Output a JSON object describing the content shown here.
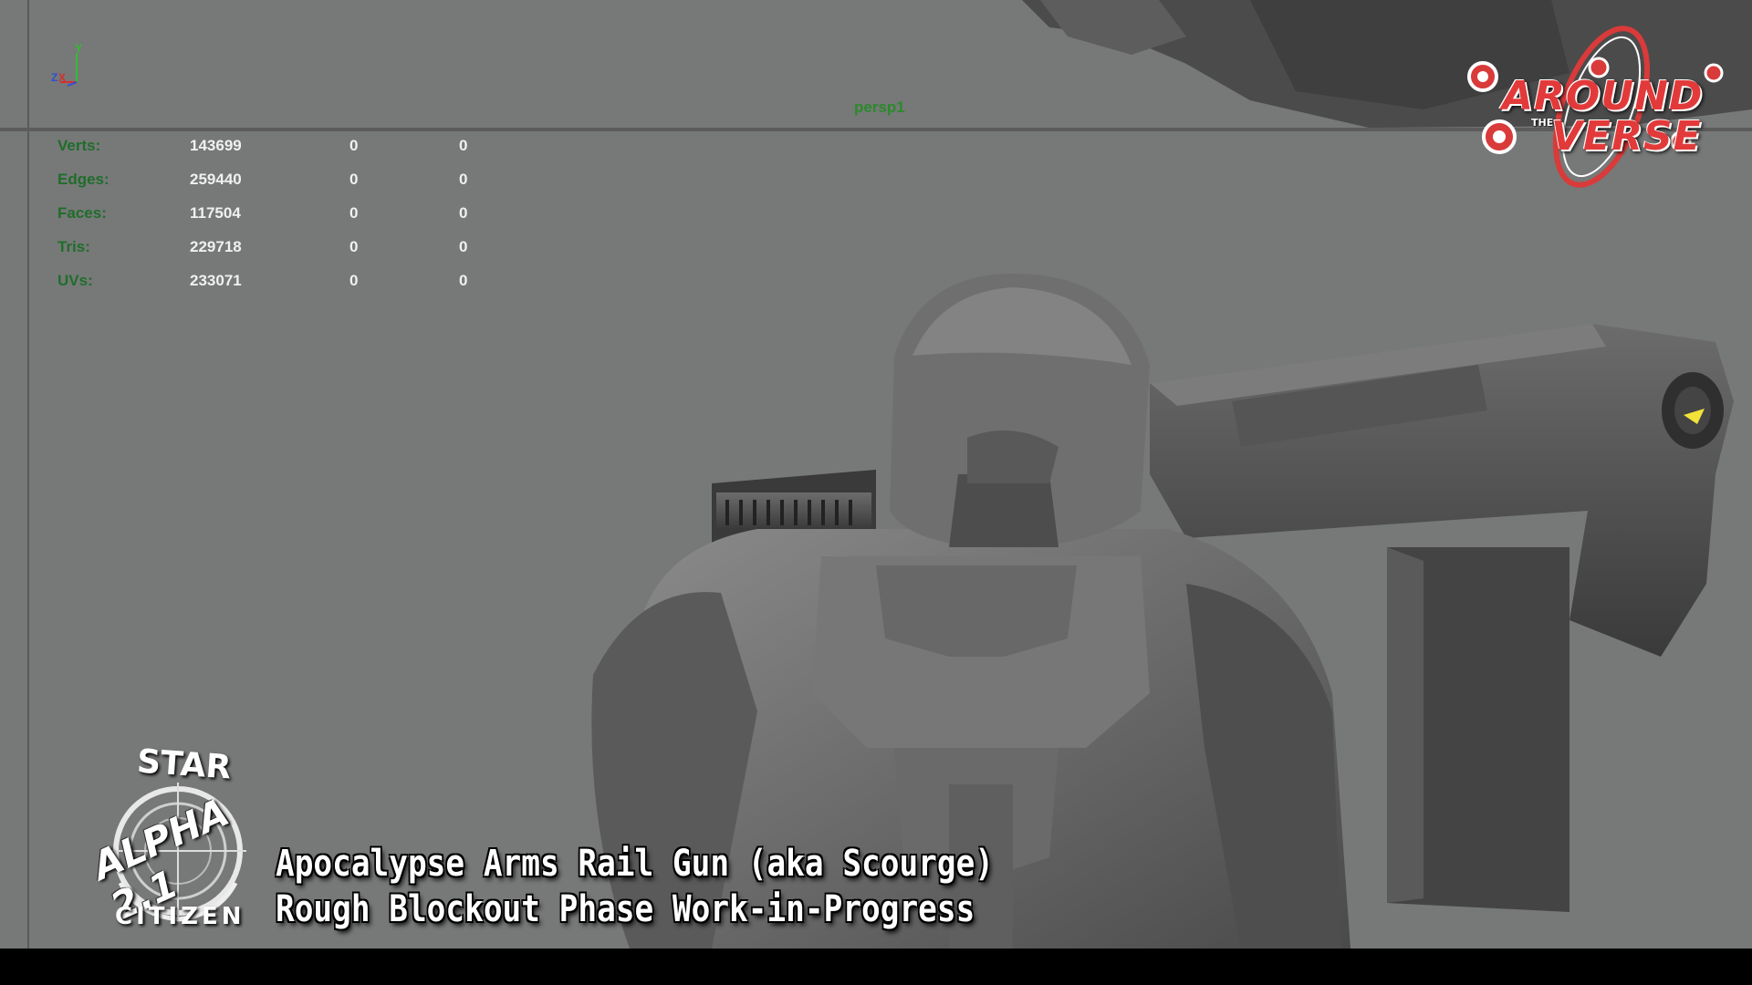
{
  "viewport": {
    "camera_label": "persp1",
    "axis_labels": {
      "y": "Y",
      "z": "Z",
      "x": "X"
    }
  },
  "poly_count": {
    "rows": [
      {
        "label": "Verts:",
        "v1": "143699",
        "v2": "0",
        "v3": "0"
      },
      {
        "label": "Edges:",
        "v1": "259440",
        "v2": "0",
        "v3": "0"
      },
      {
        "label": "Faces:",
        "v1": "117504",
        "v2": "0",
        "v3": "0"
      },
      {
        "label": "Tris:",
        "v1": "229718",
        "v2": "0",
        "v3": "0"
      },
      {
        "label": "UVs:",
        "v1": "233071",
        "v2": "0",
        "v3": "0"
      }
    ]
  },
  "overlay": {
    "atv_logo": {
      "line1": "AROUND",
      "the": "THE",
      "line2": "VERSE"
    },
    "sc_logo": {
      "top": "STAR",
      "middle": "ALPHA 2.1",
      "bottom": "CITIZEN"
    },
    "caption": {
      "line1": "Apocalypse Arms Rail Gun (aka Scourge)",
      "line2": "Rough Blockout Phase  Work-in-Progress"
    }
  },
  "colors": {
    "viewport_bg": "#777878",
    "hud_label": "#1f6e2b",
    "hud_value": "#f0f0f0",
    "camera_label": "#2b8a2b",
    "atv_red": "#e23a3a"
  }
}
